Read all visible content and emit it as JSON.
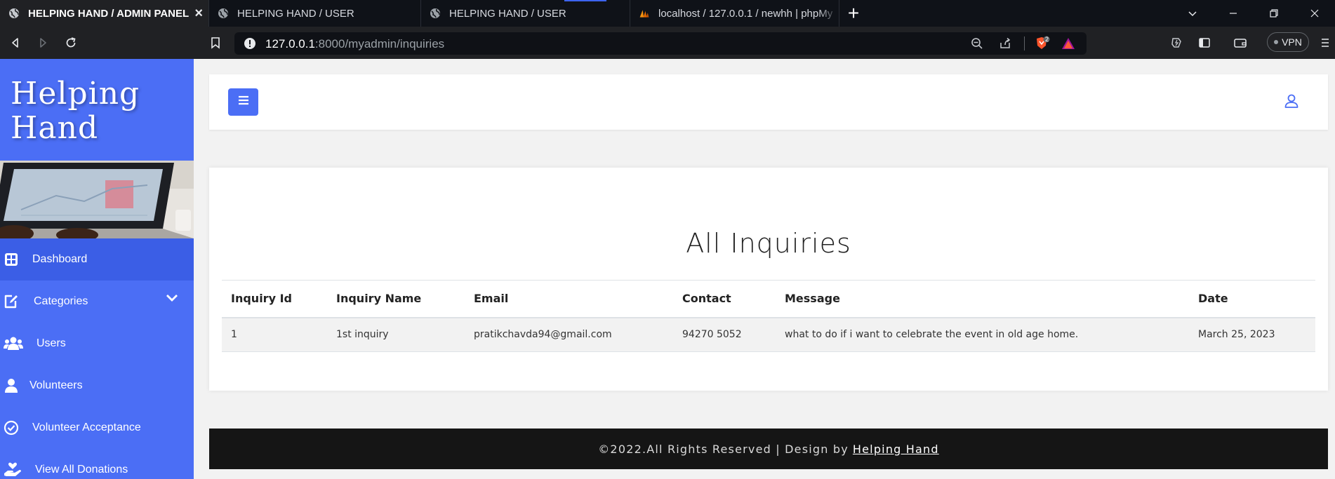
{
  "browser": {
    "tabs": [
      {
        "title": "HELPING HAND / ADMIN PANEL",
        "active": true
      },
      {
        "title": "HELPING HAND / USER",
        "active": false
      },
      {
        "title": "HELPING HAND / USER",
        "active": false
      },
      {
        "title": "localhost / 127.0.0.1 / newhh | phpMy",
        "active": false
      }
    ],
    "close_glyph": "×",
    "new_tab_glyph": "+",
    "url_host": "127.0.0.1",
    "url_path": ":8000/myadmin/inquiries",
    "shield_badge": "2",
    "vpn_label": "VPN"
  },
  "sidebar": {
    "brand_line1": "Helping",
    "brand_line2": "Hand",
    "items": [
      {
        "label": "Dashboard",
        "icon": "dashboard-grid-icon",
        "active": true
      },
      {
        "label": "Categories",
        "icon": "edit-icon",
        "has_dropdown": true
      },
      {
        "label": "Users",
        "icon": "users-icon"
      },
      {
        "label": "Volunteers",
        "icon": "user-icon"
      },
      {
        "label": "Volunteer Acceptance",
        "icon": "check-circle-icon"
      },
      {
        "label": "View All Donations",
        "icon": "hand-heart-icon"
      }
    ]
  },
  "page": {
    "title": "All Inquiries",
    "table": {
      "columns": [
        "Inquiry Id",
        "Inquiry Name",
        "Email",
        "Contact",
        "Message",
        "Date"
      ],
      "rows": [
        [
          "1",
          "1st inquiry",
          "pratikchavda94@gmail.com",
          "94270 5052",
          "what to do if i want to celebrate the event in old age home.",
          "March 25, 2023"
        ]
      ]
    }
  },
  "footer": {
    "text": "©2022.All Rights Reserved | Design by",
    "link": "Helping Hand"
  },
  "colors": {
    "accent": "#4b6ef5",
    "sidebar_active": "#3b5ee6",
    "footer_bg": "#151515",
    "page_bg": "#f2f2f2"
  }
}
